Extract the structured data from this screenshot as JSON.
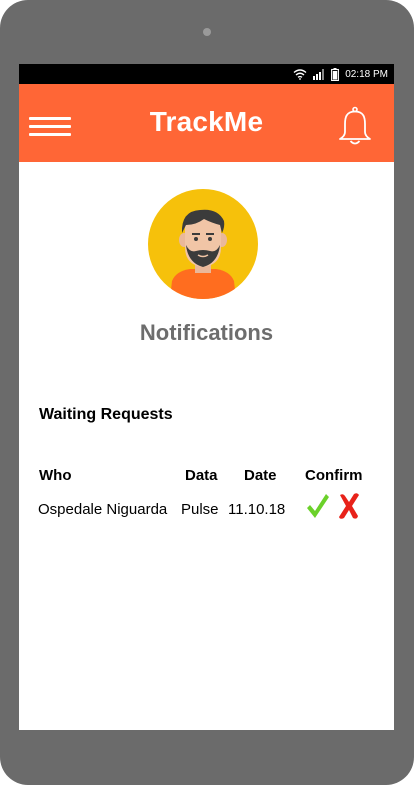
{
  "status_bar": {
    "time": "02:18 PM"
  },
  "app_bar": {
    "title": "TrackMe"
  },
  "page": {
    "title": "Notifications"
  },
  "requests": {
    "heading": "Waiting Requests",
    "columns": {
      "who": "Who",
      "data": "Data",
      "date": "Date",
      "confirm": "Confirm"
    },
    "rows": [
      {
        "who": "Ospedale Niguarda",
        "data": "Pulse",
        "date": "11.10.18"
      }
    ]
  },
  "colors": {
    "accent": "#ff6636",
    "title_gray": "#6d6d6d",
    "accept_green": "#6bd12a",
    "reject_red": "#e8221a"
  },
  "icons": [
    "menu-icon",
    "bell-icon",
    "avatar",
    "wifi-icon",
    "signal-icon",
    "battery-icon",
    "check-icon",
    "cross-icon"
  ]
}
